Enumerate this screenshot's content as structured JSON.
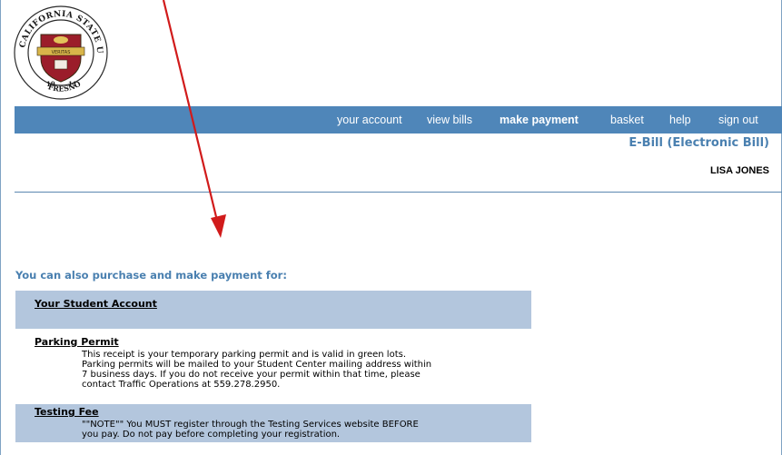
{
  "logo": {
    "icon": "csu-fresno-seal-icon",
    "text_top": "CALIFORNIA STATE UNIVERSITY",
    "text_bottom": "FRESNO",
    "motto": "VERITAS",
    "year_left": "19",
    "year_right": "11"
  },
  "nav": {
    "items": [
      {
        "label": "your account"
      },
      {
        "label": "view bills"
      },
      {
        "label": "make payment"
      },
      {
        "label": "basket"
      },
      {
        "label": "help"
      },
      {
        "label": "sign out"
      }
    ],
    "active": "make payment",
    "bar_color": "#4f86b9"
  },
  "header": {
    "title": "E-Bill (Electronic Bill)",
    "user": "LISA JONES"
  },
  "annotation": {
    "arrow_color": "#d11b1b"
  },
  "main": {
    "heading": "You can also purchase and make payment for:",
    "options": [
      {
        "title": "Your Student Account",
        "description": []
      },
      {
        "title": "Parking Permit",
        "description": [
          "This receipt is your temporary parking permit and is valid in green lots.",
          "Parking permits will be mailed to your Student Center mailing address within",
          "7 business days. If you do not receive your permit within that time, please",
          "contact Traffic Operations at 559.278.2950."
        ]
      },
      {
        "title": "Testing Fee",
        "description": [
          "\"\"NOTE\"\" You MUST register through the Testing Services website BEFORE",
          "you pay. Do not pay before completing your registration."
        ]
      }
    ]
  }
}
